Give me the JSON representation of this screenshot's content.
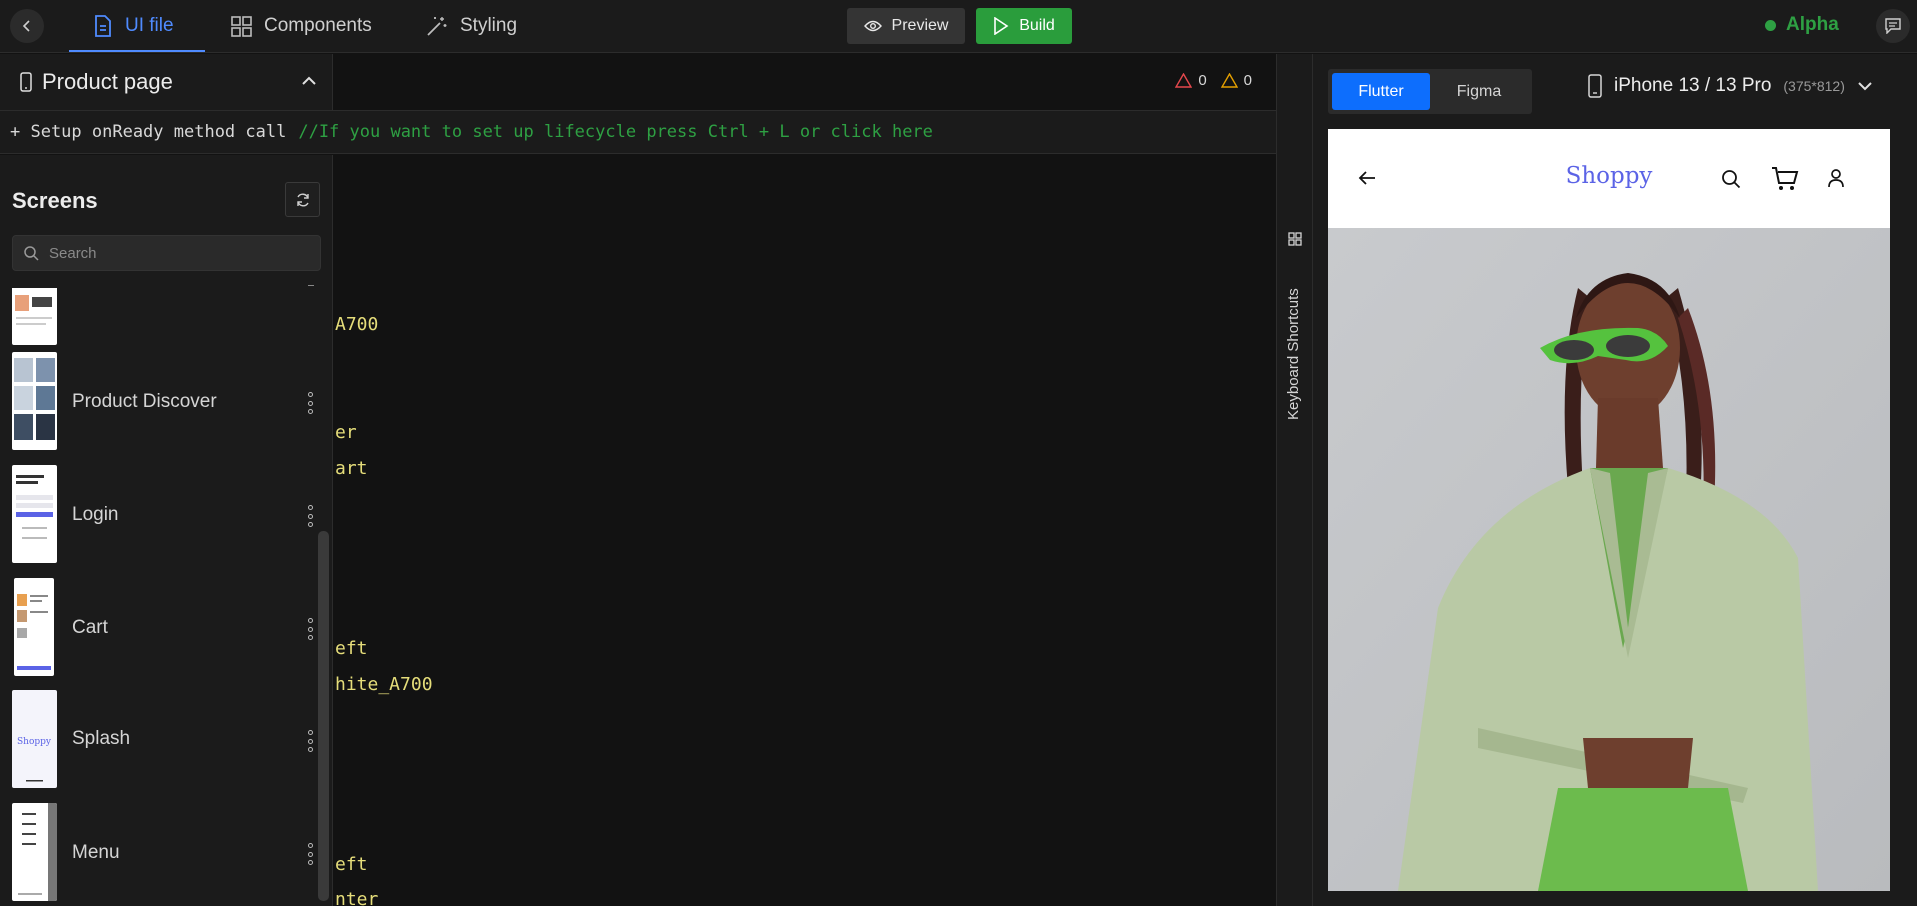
{
  "topbar": {
    "tabs": [
      {
        "label": "UI file",
        "active": true
      },
      {
        "label": "Components",
        "active": false
      },
      {
        "label": "Styling",
        "active": false
      }
    ],
    "preview_label": "Preview",
    "build_label": "Build",
    "status_label": "Alpha"
  },
  "page": {
    "title": "Product page",
    "errors": "0",
    "warnings": "0"
  },
  "setup": {
    "text": "+ Setup onReady method call",
    "comment": "//If you want to set up lifecycle press Ctrl + L or click here"
  },
  "screens": {
    "title": "Screens",
    "search_placeholder": "Search",
    "items": [
      {
        "label": ""
      },
      {
        "label": "Product Discover"
      },
      {
        "label": "Login"
      },
      {
        "label": "Cart"
      },
      {
        "label": "Splash"
      },
      {
        "label": "Menu"
      }
    ]
  },
  "code": {
    "lines": [
      "A700",
      "er",
      "art",
      "eft",
      "hite_A700",
      "eft",
      "nter"
    ]
  },
  "sidebar_strip": {
    "label": "Keyboard Shortcuts"
  },
  "preview": {
    "platforms": [
      {
        "label": "Flutter",
        "active": true
      },
      {
        "label": "Figma",
        "active": false
      }
    ],
    "device_name": "iPhone 13 / 13 Pro",
    "device_dims": "(375*812)",
    "app": {
      "brand": "Shoppy"
    }
  },
  "colors": {
    "accent_blue": "#4f8bff",
    "build_green": "#2a9d3c",
    "code_yellow": "#e5dd7a",
    "comment_green": "#2ea043",
    "brand_purple": "#5b63e6"
  }
}
